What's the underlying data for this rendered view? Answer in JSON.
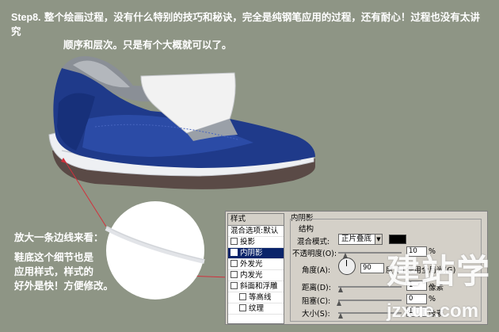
{
  "title": {
    "step": "Step8.",
    "line1": "整个绘画过程，没有什么特别的技巧和秘诀，完全是纯钢笔应用的过程，还有耐心！过程也没有太讲究",
    "line2": "顺序和层次。只是有个大概就可以了。"
  },
  "notes": {
    "magnify": "放大一条边线来看：",
    "detail_line1": "鞋底这个细节也是",
    "detail_line2": "应用样式，样式的",
    "detail_line3": "好外是快！方便修改。"
  },
  "ps_panel": {
    "styles_header": "样式",
    "styles": [
      {
        "label": "混合选项:默认",
        "checkbox": false,
        "selected": false
      },
      {
        "label": "投影",
        "checkbox": true,
        "selected": false
      },
      {
        "label": "内阴影",
        "checkbox": true,
        "selected": true
      },
      {
        "label": "外发光",
        "checkbox": true,
        "selected": false
      },
      {
        "label": "内发光",
        "checkbox": true,
        "selected": false
      },
      {
        "label": "斜面和浮雕",
        "checkbox": true,
        "selected": false
      },
      {
        "label": "等高线",
        "checkbox": true,
        "selected": false
      },
      {
        "label": "纹理",
        "checkbox": true,
        "selected": false
      }
    ],
    "section_title": "内阴影",
    "group_title": "结构",
    "blend_mode_label": "混合模式:",
    "blend_mode_value": "正片叠底",
    "opacity_label": "不透明度(O):",
    "opacity_value": "10",
    "opacity_unit": "%",
    "angle_label": "角度(A):",
    "angle_value": "90",
    "angle_unit": "度",
    "global_light_label": "使用全局光(G)",
    "distance_label": "距离(D):",
    "distance_value": "1",
    "distance_unit": "像素",
    "choke_label": "阻塞(C):",
    "choke_value": "0",
    "choke_unit": "%",
    "size_label": "大小(S):",
    "size_value": "1",
    "size_unit": "像素"
  },
  "watermark": {
    "cn": "建站学",
    "url": "jzxue.com"
  },
  "colors": {
    "background": "#8e9585",
    "shoe_blue": "#1f3a8a",
    "sole": "#5a4a46",
    "accent_line": "#d2303c"
  }
}
